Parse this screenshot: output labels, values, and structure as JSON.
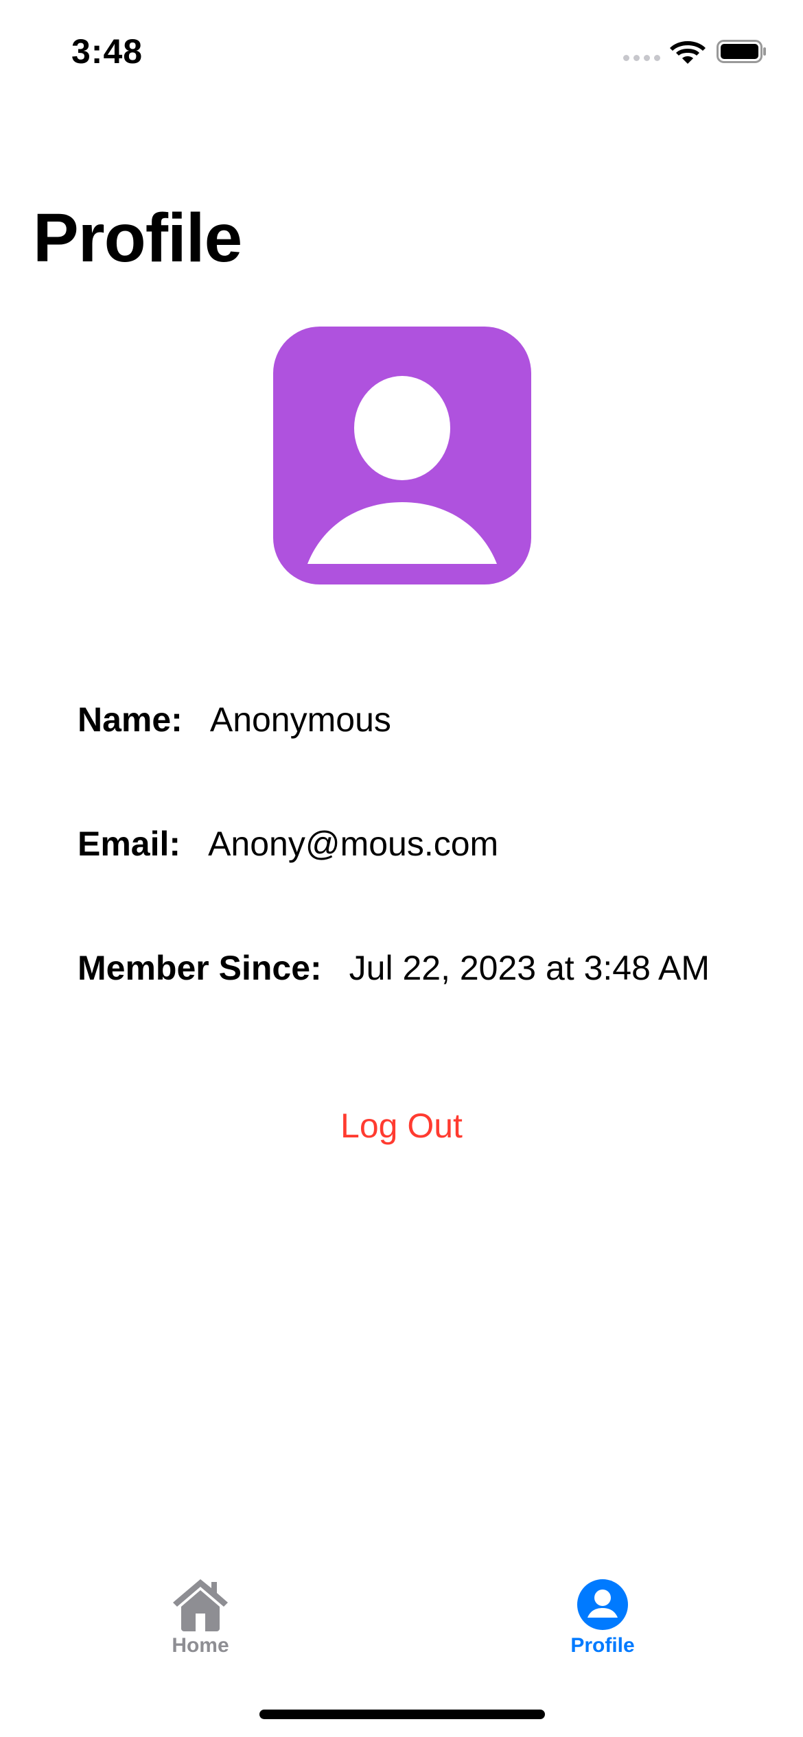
{
  "status_bar": {
    "time": "3:48"
  },
  "header": {
    "title": "Profile"
  },
  "avatar": {
    "icon": "person-icon",
    "color": "#af52de"
  },
  "info": {
    "name_label": "Name:",
    "name_value": "Anonymous",
    "email_label": "Email:",
    "email_value": "Anony@mous.com",
    "member_label": "Member Since:",
    "member_value": "Jul 22, 2023 at 3:48 AM"
  },
  "actions": {
    "logout_label": "Log Out",
    "logout_color": "#ff3b30"
  },
  "tab_bar": {
    "home_label": "Home",
    "profile_label": "Profile",
    "selected": "Profile",
    "inactive_color": "#8e8e93",
    "active_color": "#007aff"
  }
}
